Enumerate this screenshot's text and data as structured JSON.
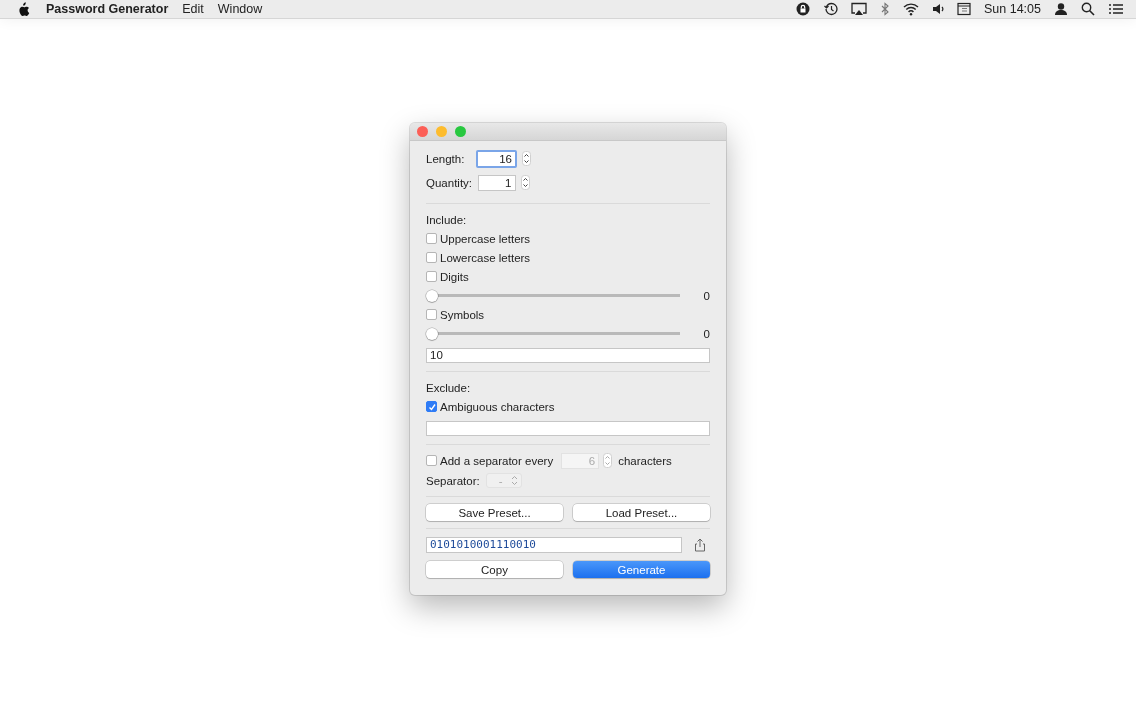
{
  "menu_bar": {
    "app_name": "Password Generator",
    "menus": [
      "Edit",
      "Window"
    ],
    "clock": "Sun 14:05"
  },
  "window": {
    "length": {
      "label": "Length:",
      "value": "16",
      "focused": true
    },
    "quantity": {
      "label": "Quantity:",
      "value": "1",
      "focused": false
    },
    "include": {
      "label": "Include:",
      "items": [
        {
          "kind": "checkbox",
          "label": "Uppercase letters",
          "checked": false
        },
        {
          "kind": "checkbox",
          "label": "Lowercase letters",
          "checked": false
        },
        {
          "kind": "checkbox",
          "label": "Digits",
          "checked": false
        },
        {
          "kind": "slider",
          "level": 0,
          "reading": "0"
        },
        {
          "kind": "checkbox",
          "label": "Symbols",
          "checked": false
        },
        {
          "kind": "slider",
          "level": 0,
          "reading": "0"
        }
      ],
      "field_value": "10"
    },
    "exclude": {
      "label": "Exclude:",
      "items": [
        {
          "kind": "checkbox",
          "label": "Ambiguous characters",
          "checked": true
        }
      ]
    },
    "separator": {
      "checked": false,
      "label": "Add a separator every",
      "value": "6",
      "suffix": "characters",
      "disabled": true
    },
    "separator_select": {
      "label": "Separator:",
      "value": "-",
      "disabled": true
    },
    "preset_buttons": [
      "Save Preset...",
      "Load Preset..."
    ],
    "output": "0101010001110010",
    "actions": [
      {
        "label": "Copy",
        "primary": false
      },
      {
        "label": "Generate",
        "primary": true
      }
    ]
  }
}
